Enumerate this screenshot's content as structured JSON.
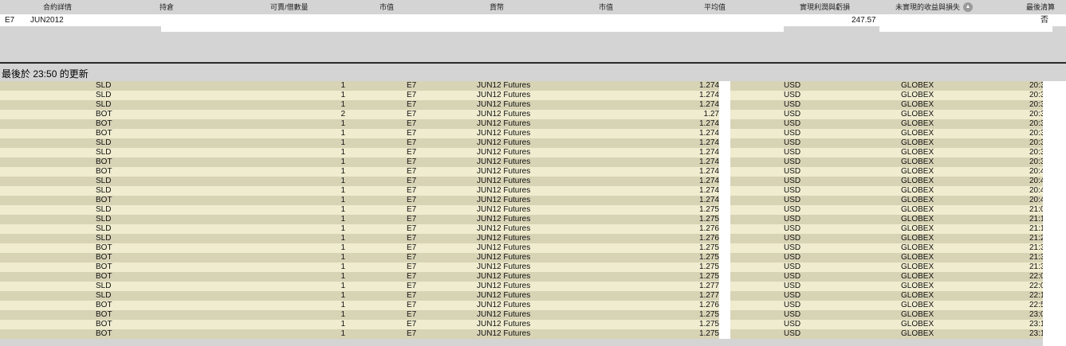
{
  "portfolio": {
    "columns": {
      "contract_details": "合約詳情",
      "position": "持倉",
      "available_qty": "可賣/借數量",
      "market_value": "市值",
      "currency": "貨幣",
      "market_price": "市值",
      "avg_price": "平均值",
      "realized_pnl": "實現利潤與虧損",
      "unrealized_pnl": "未實現的收益與損失",
      "liquidate_last": "最後清算"
    },
    "row": {
      "symbol": "E7",
      "expiry": "JUN2012",
      "unrealized_pnl": "247.57",
      "liquidate_last": "否"
    }
  },
  "status": {
    "last_updated": "最後於 23:50 的更新"
  },
  "trades": [
    {
      "action": "SLD",
      "qty": "1",
      "symbol": "E7",
      "description": "JUN12 Futures",
      "price": "1.274",
      "currency": "USD",
      "exchange": "GLOBEX",
      "time": "20:3"
    },
    {
      "action": "SLD",
      "qty": "1",
      "symbol": "E7",
      "description": "JUN12 Futures",
      "price": "1.274",
      "currency": "USD",
      "exchange": "GLOBEX",
      "time": "20:3"
    },
    {
      "action": "SLD",
      "qty": "1",
      "symbol": "E7",
      "description": "JUN12 Futures",
      "price": "1.274",
      "currency": "USD",
      "exchange": "GLOBEX",
      "time": "20:3"
    },
    {
      "action": "BOT",
      "qty": "2",
      "symbol": "E7",
      "description": "JUN12 Futures",
      "price": "1.27",
      "currency": "USD",
      "exchange": "GLOBEX",
      "time": "20:3"
    },
    {
      "action": "BOT",
      "qty": "1",
      "symbol": "E7",
      "description": "JUN12 Futures",
      "price": "1.274",
      "currency": "USD",
      "exchange": "GLOBEX",
      "time": "20:3"
    },
    {
      "action": "BOT",
      "qty": "1",
      "symbol": "E7",
      "description": "JUN12 Futures",
      "price": "1.274",
      "currency": "USD",
      "exchange": "GLOBEX",
      "time": "20:3"
    },
    {
      "action": "SLD",
      "qty": "1",
      "symbol": "E7",
      "description": "JUN12 Futures",
      "price": "1.274",
      "currency": "USD",
      "exchange": "GLOBEX",
      "time": "20:3"
    },
    {
      "action": "SLD",
      "qty": "1",
      "symbol": "E7",
      "description": "JUN12 Futures",
      "price": "1.274",
      "currency": "USD",
      "exchange": "GLOBEX",
      "time": "20:3"
    },
    {
      "action": "BOT",
      "qty": "1",
      "symbol": "E7",
      "description": "JUN12 Futures",
      "price": "1.274",
      "currency": "USD",
      "exchange": "GLOBEX",
      "time": "20:3"
    },
    {
      "action": "BOT",
      "qty": "1",
      "symbol": "E7",
      "description": "JUN12 Futures",
      "price": "1.274",
      "currency": "USD",
      "exchange": "GLOBEX",
      "time": "20:4"
    },
    {
      "action": "SLD",
      "qty": "1",
      "symbol": "E7",
      "description": "JUN12 Futures",
      "price": "1.274",
      "currency": "USD",
      "exchange": "GLOBEX",
      "time": "20:4"
    },
    {
      "action": "SLD",
      "qty": "1",
      "symbol": "E7",
      "description": "JUN12 Futures",
      "price": "1.274",
      "currency": "USD",
      "exchange": "GLOBEX",
      "time": "20:4"
    },
    {
      "action": "BOT",
      "qty": "1",
      "symbol": "E7",
      "description": "JUN12 Futures",
      "price": "1.274",
      "currency": "USD",
      "exchange": "GLOBEX",
      "time": "20:4"
    },
    {
      "action": "SLD",
      "qty": "1",
      "symbol": "E7",
      "description": "JUN12 Futures",
      "price": "1.275",
      "currency": "USD",
      "exchange": "GLOBEX",
      "time": "21:0"
    },
    {
      "action": "SLD",
      "qty": "1",
      "symbol": "E7",
      "description": "JUN12 Futures",
      "price": "1.275",
      "currency": "USD",
      "exchange": "GLOBEX",
      "time": "21:1"
    },
    {
      "action": "SLD",
      "qty": "1",
      "symbol": "E7",
      "description": "JUN12 Futures",
      "price": "1.276",
      "currency": "USD",
      "exchange": "GLOBEX",
      "time": "21:1"
    },
    {
      "action": "SLD",
      "qty": "1",
      "symbol": "E7",
      "description": "JUN12 Futures",
      "price": "1.276",
      "currency": "USD",
      "exchange": "GLOBEX",
      "time": "21:2"
    },
    {
      "action": "BOT",
      "qty": "1",
      "symbol": "E7",
      "description": "JUN12 Futures",
      "price": "1.275",
      "currency": "USD",
      "exchange": "GLOBEX",
      "time": "21:3"
    },
    {
      "action": "BOT",
      "qty": "1",
      "symbol": "E7",
      "description": "JUN12 Futures",
      "price": "1.275",
      "currency": "USD",
      "exchange": "GLOBEX",
      "time": "21:3"
    },
    {
      "action": "BOT",
      "qty": "1",
      "symbol": "E7",
      "description": "JUN12 Futures",
      "price": "1.275",
      "currency": "USD",
      "exchange": "GLOBEX",
      "time": "21:3"
    },
    {
      "action": "BOT",
      "qty": "1",
      "symbol": "E7",
      "description": "JUN12 Futures",
      "price": "1.275",
      "currency": "USD",
      "exchange": "GLOBEX",
      "time": "22:0"
    },
    {
      "action": "SLD",
      "qty": "1",
      "symbol": "E7",
      "description": "JUN12 Futures",
      "price": "1.277",
      "currency": "USD",
      "exchange": "GLOBEX",
      "time": "22:0"
    },
    {
      "action": "SLD",
      "qty": "1",
      "symbol": "E7",
      "description": "JUN12 Futures",
      "price": "1.277",
      "currency": "USD",
      "exchange": "GLOBEX",
      "time": "22:1"
    },
    {
      "action": "BOT",
      "qty": "1",
      "symbol": "E7",
      "description": "JUN12 Futures",
      "price": "1.276",
      "currency": "USD",
      "exchange": "GLOBEX",
      "time": "22:5"
    },
    {
      "action": "BOT",
      "qty": "1",
      "symbol": "E7",
      "description": "JUN12 Futures",
      "price": "1.275",
      "currency": "USD",
      "exchange": "GLOBEX",
      "time": "23:0"
    },
    {
      "action": "BOT",
      "qty": "1",
      "symbol": "E7",
      "description": "JUN12 Futures",
      "price": "1.275",
      "currency": "USD",
      "exchange": "GLOBEX",
      "time": "23:1"
    },
    {
      "action": "BOT",
      "qty": "1",
      "symbol": "E7",
      "description": "JUN12 Futures",
      "price": "1.275",
      "currency": "USD",
      "exchange": "GLOBEX",
      "time": "23:1"
    }
  ]
}
